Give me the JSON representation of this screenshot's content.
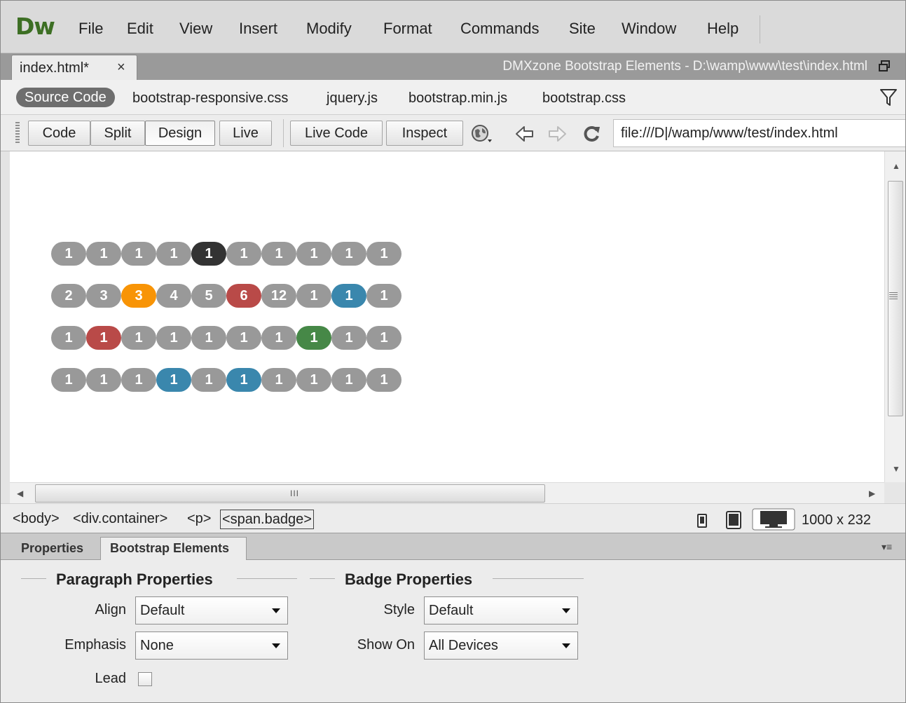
{
  "app": {
    "logo": "Dw"
  },
  "menu": [
    "File",
    "Edit",
    "View",
    "Insert",
    "Modify",
    "Format",
    "Commands",
    "Site",
    "Window",
    "Help"
  ],
  "document": {
    "tab_label": "index.html*",
    "close_glyph": "×",
    "window_title": "DMXzone Bootstrap Elements - D:\\wamp\\www\\test\\index.html"
  },
  "related_files": {
    "source_code": "Source Code",
    "files": [
      "bootstrap-responsive.css",
      "jquery.js",
      "bootstrap.min.js",
      "bootstrap.css"
    ]
  },
  "toolbar": {
    "code": "Code",
    "split": "Split",
    "design": "Design",
    "live": "Live",
    "live_code": "Live Code",
    "inspect": "Inspect",
    "url": "file:///D|/wamp/www/test/index.html"
  },
  "colors": {
    "gray": "#999999",
    "dark": "#333333",
    "orange": "#f89406",
    "red": "#b94a48",
    "blue": "#3a87ad",
    "green": "#468847"
  },
  "badges": [
    [
      [
        "1",
        "gray"
      ],
      [
        "1",
        "gray"
      ],
      [
        "1",
        "gray"
      ],
      [
        "1",
        "gray"
      ],
      [
        "1",
        "dark"
      ],
      [
        "1",
        "gray"
      ],
      [
        "1",
        "gray"
      ],
      [
        "1",
        "gray"
      ],
      [
        "1",
        "gray"
      ],
      [
        "1",
        "gray"
      ]
    ],
    [
      [
        "2",
        "gray"
      ],
      [
        "3",
        "gray"
      ],
      [
        "3",
        "orange"
      ],
      [
        "4",
        "gray"
      ],
      [
        "5",
        "gray"
      ],
      [
        "6",
        "red"
      ],
      [
        "12",
        "gray"
      ],
      [
        "1",
        "gray"
      ],
      [
        "1",
        "blue"
      ],
      [
        "1",
        "gray"
      ]
    ],
    [
      [
        "1",
        "gray"
      ],
      [
        "1",
        "red"
      ],
      [
        "1",
        "gray"
      ],
      [
        "1",
        "gray"
      ],
      [
        "1",
        "gray"
      ],
      [
        "1",
        "gray"
      ],
      [
        "1",
        "gray"
      ],
      [
        "1",
        "green"
      ],
      [
        "1",
        "gray"
      ],
      [
        "1",
        "gray"
      ]
    ],
    [
      [
        "1",
        "gray"
      ],
      [
        "1",
        "gray"
      ],
      [
        "1",
        "gray"
      ],
      [
        "1",
        "blue"
      ],
      [
        "1",
        "gray"
      ],
      [
        "1",
        "blue"
      ],
      [
        "1",
        "gray"
      ],
      [
        "1",
        "gray"
      ],
      [
        "1",
        "gray"
      ],
      [
        "1",
        "gray"
      ]
    ]
  ],
  "status": {
    "tags": [
      "<body>",
      "<div.container>",
      "<p>",
      "<span.badge>"
    ],
    "window_size": "1000 x 232",
    "hscroll_grip": "III"
  },
  "panel": {
    "tabs": [
      "Properties",
      "Bootstrap Elements"
    ],
    "paragraph": {
      "title": "Paragraph Properties",
      "align_label": "Align",
      "align_value": "Default",
      "emphasis_label": "Emphasis",
      "emphasis_value": "None",
      "lead_label": "Lead"
    },
    "badge": {
      "title": "Badge Properties",
      "style_label": "Style",
      "style_value": "Default",
      "show_on_label": "Show On",
      "show_on_value": "All Devices"
    }
  }
}
